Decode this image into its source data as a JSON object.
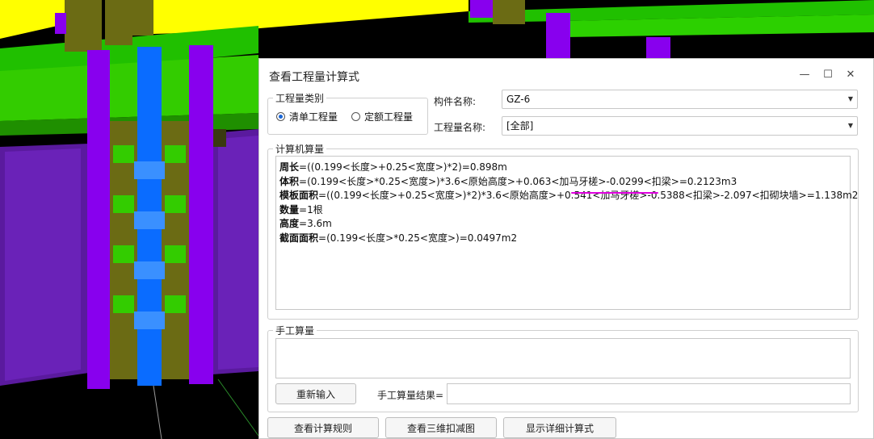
{
  "dialog": {
    "title": "查看工程量计算式",
    "window_buttons": {
      "minimize": "—",
      "maximize": "☐",
      "close": "✕"
    }
  },
  "quantity_type": {
    "legend": "工程量类别",
    "options": [
      {
        "label": "清单工程量",
        "selected": true
      },
      {
        "label": "定额工程量",
        "selected": false
      }
    ]
  },
  "component": {
    "name_label": "构件名称:",
    "name_value": "GZ-6",
    "qty_label": "工程量名称:",
    "qty_value": "[全部]"
  },
  "computer_calc": {
    "legend": "计算机算量",
    "lines": [
      {
        "name": "周长",
        "expr": "=((0.199<长度>+0.25<宽度>)*2)=0.898m"
      },
      {
        "name": "体积",
        "expr": "=(0.199<长度>*0.25<宽度>)*3.6<原始高度>+0.063<加马牙槎>-0.0299<扣梁>=0.2123m3"
      },
      {
        "name": "模板面积",
        "expr": "=((0.199<长度>+0.25<宽度>)*2)*3.6<原始高度>+0.541<加马牙槎>-0.5388<扣梁>-2.097<扣砌块墙>=1.138m2"
      },
      {
        "name": "数量",
        "expr": "=1根"
      },
      {
        "name": "高度",
        "expr": "=3.6m"
      },
      {
        "name": "截面面积",
        "expr": "=(0.199<长度>*0.25<宽度>)=0.0497m2"
      }
    ]
  },
  "manual_calc": {
    "legend": "手工算量",
    "reinput_label": "重新输入",
    "result_label": "手工算量结果=",
    "result_value": ""
  },
  "footer": {
    "rules_label": "查看计算规则",
    "deduct3d_label": "查看三维扣减图",
    "detail_label": "显示详细计算式"
  },
  "colors": {
    "highlight_underline": "#e000e0",
    "radio_selected": "#1a66d6",
    "scene_green": "#33cc00",
    "scene_purple": "#8800ee",
    "scene_blue": "#0a6cff",
    "scene_olive": "#6b6b14",
    "scene_yellow": "#ffff00"
  }
}
